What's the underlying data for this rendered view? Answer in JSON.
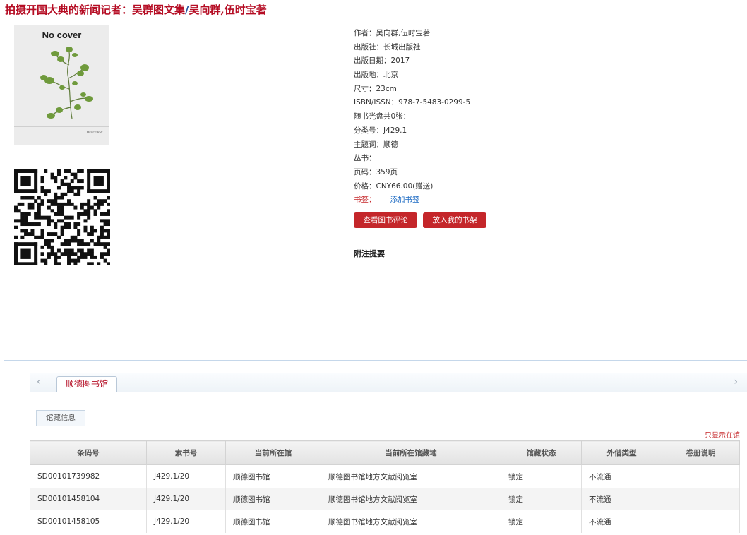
{
  "title": {
    "book": "拍摄开国大典的新闻记者：吴群图文集",
    "separator": "/",
    "authors": "吴向群,伍时宝著"
  },
  "cover": {
    "text_main": "No cover",
    "text_small": "no cover"
  },
  "meta": {
    "author": "作者：吴向群,伍时宝著",
    "publisher": "出版社：长城出版社",
    "pub_date": "出版日期：2017",
    "pub_place": "出版地：北京",
    "size": "尺寸：23cm",
    "isbn": "ISBN/ISSN：978-7-5483-0299-5",
    "disc": "随书光盘共0张：",
    "class_no": "分类号：J429.1",
    "subject": "主题词：顺德",
    "series": "丛书：",
    "pages": "页码：359页",
    "price": "价格：CNY66.00(赠送)",
    "bookmark_label": "书签：",
    "add_bookmark": "添加书签"
  },
  "buttons": {
    "review": "查看图书评论",
    "shelf": "放入我的书架"
  },
  "attach": "附注提要",
  "tabs": {
    "prev": "‹",
    "next": "›",
    "library": "顺德图书馆",
    "holdings": "馆藏信息",
    "only_in": "只显示在馆"
  },
  "table": {
    "headers": [
      "条码号",
      "索书号",
      "当前所在馆",
      "当前所在馆藏地",
      "馆藏状态",
      "外借类型",
      "卷册说明"
    ],
    "rows": [
      [
        "SD00101739982",
        "J429.1/20",
        "顺德图书馆",
        "顺德图书馆地方文献阅览室",
        "锁定",
        "不流通",
        ""
      ],
      [
        "SD00101458104",
        "J429.1/20",
        "顺德图书馆",
        "顺德图书馆地方文献阅览室",
        "锁定",
        "不流通",
        ""
      ],
      [
        "SD00101458105",
        "J429.1/20",
        "顺德图书馆",
        "顺德图书馆地方文献阅览室",
        "锁定",
        "不流通",
        ""
      ]
    ]
  },
  "colors": {
    "accent_red": "#b50d24",
    "button_red": "#c4262a",
    "link_blue": "#1f6cc4"
  }
}
